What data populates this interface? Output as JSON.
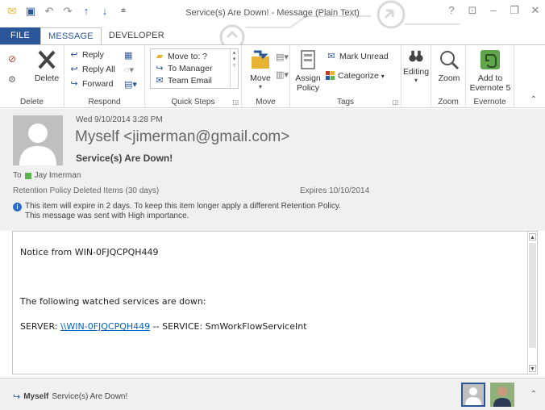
{
  "window": {
    "title": "Service(s) Are Down! - Message (Plain Text)",
    "controls": {
      "help": "?",
      "ribbon_display": "⊡",
      "minimize": "–",
      "restore": "❐",
      "close": "✕"
    }
  },
  "quick_access": {
    "icons": [
      "envelope-icon",
      "save-icon",
      "undo-icon",
      "redo-icon",
      "up-arrow-icon",
      "down-arrow-icon",
      "customize-icon"
    ]
  },
  "tabs": [
    {
      "label": "FILE"
    },
    {
      "label": "MESSAGE"
    },
    {
      "label": "DEVELOPER"
    }
  ],
  "ribbon": {
    "delete": {
      "label": "Delete",
      "group": "Delete"
    },
    "respond": {
      "group": "Respond",
      "reply": "Reply",
      "reply_all": "Reply All",
      "forward": "Forward"
    },
    "quick_steps": {
      "group": "Quick Steps",
      "items": [
        "Move to: ?",
        "To Manager",
        "Team Email"
      ]
    },
    "move": {
      "label": "Move",
      "group": "Move"
    },
    "tags": {
      "group": "Tags",
      "assign_line1": "Assign",
      "assign_line2": "Policy",
      "mark_unread": "Mark Unread",
      "categorize": "Categorize"
    },
    "editing": {
      "label": "Editing"
    },
    "zoom": {
      "label": "Zoom",
      "group": "Zoom"
    },
    "evernote": {
      "line1": "Add to",
      "line2": "Evernote 5",
      "group": "Evernote"
    }
  },
  "header": {
    "date": "Wed 9/10/2014 3:28 PM",
    "from": "Myself <jimerman@gmail.com>",
    "subject": "Service(s) Are Down!",
    "to_label": "To",
    "to_name": "Jay Imerman",
    "retention": "Retention Policy   Deleted Items (30 days)",
    "expires": "Expires   10/10/2014",
    "info_line1": "This item will expire in 2 days. To keep this item longer apply a different Retention Policy.",
    "info_line2": "This message was sent with High importance."
  },
  "body": {
    "line1": "Notice from WIN-0FJQCPQH449",
    "line2": "The following watched services are down:",
    "server_prefix": "SERVER: ",
    "server_link": "\\\\WIN-0FJQCPQH449",
    "server_suffix": " -- SERVICE: SmWorkFlowServiceInt"
  },
  "people_pane": {
    "sender": "Myself",
    "subject": "Service(s) Are Down!"
  },
  "colors": {
    "accent": "#2b579a",
    "link": "#0563c1",
    "presence_green": "#5fb34f",
    "evernote_green": "#5fa54a"
  }
}
